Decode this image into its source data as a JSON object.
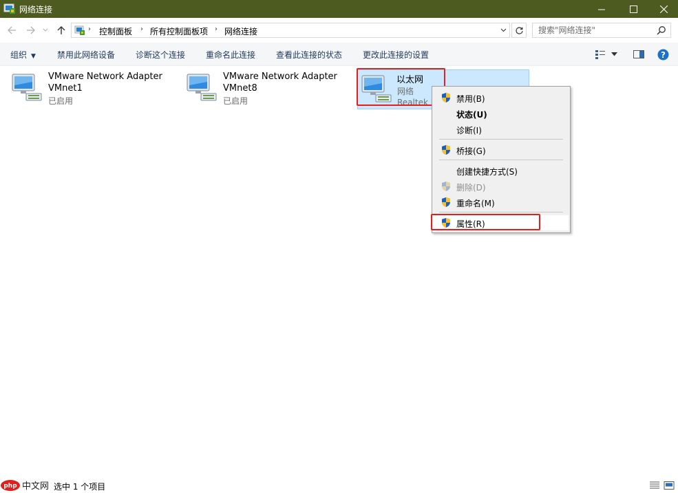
{
  "window": {
    "title": "网络连接"
  },
  "address": {
    "crumbs": [
      "控制面板",
      "所有控制面板项",
      "网络连接"
    ],
    "search_placeholder": "搜索\"网络连接\""
  },
  "commands": {
    "organize": "组织",
    "disable": "禁用此网络设备",
    "diagnose": "诊断这个连接",
    "rename": "重命名此连接",
    "status": "查看此连接的状态",
    "change_settings": "更改此连接的设置"
  },
  "connections": [
    {
      "name": "VMware Network Adapter",
      "name2": "VMnet1",
      "status": "已启用"
    },
    {
      "name": "VMware Network Adapter",
      "name2": "VMnet8",
      "status": "已启用"
    },
    {
      "name": "以太网",
      "network": "网络",
      "adapter": "Realtek P"
    }
  ],
  "context_menu": {
    "items": [
      {
        "label": "禁用(B)"
      },
      {
        "label": "状态(U)"
      },
      {
        "label": "诊断(I)"
      },
      {
        "label": "桥接(G)"
      },
      {
        "label": "创建快捷方式(S)"
      },
      {
        "label": "删除(D)"
      },
      {
        "label": "重命名(M)"
      },
      {
        "label": "属性(R)"
      }
    ]
  },
  "statusbar": {
    "count_text": "选中 1 个项目",
    "logo_text": "php中文网"
  },
  "colors": {
    "titlebar": "#4d5a20",
    "highlight": "#e0201c",
    "selection": "#cce8ff",
    "accent": "#1e395b"
  }
}
